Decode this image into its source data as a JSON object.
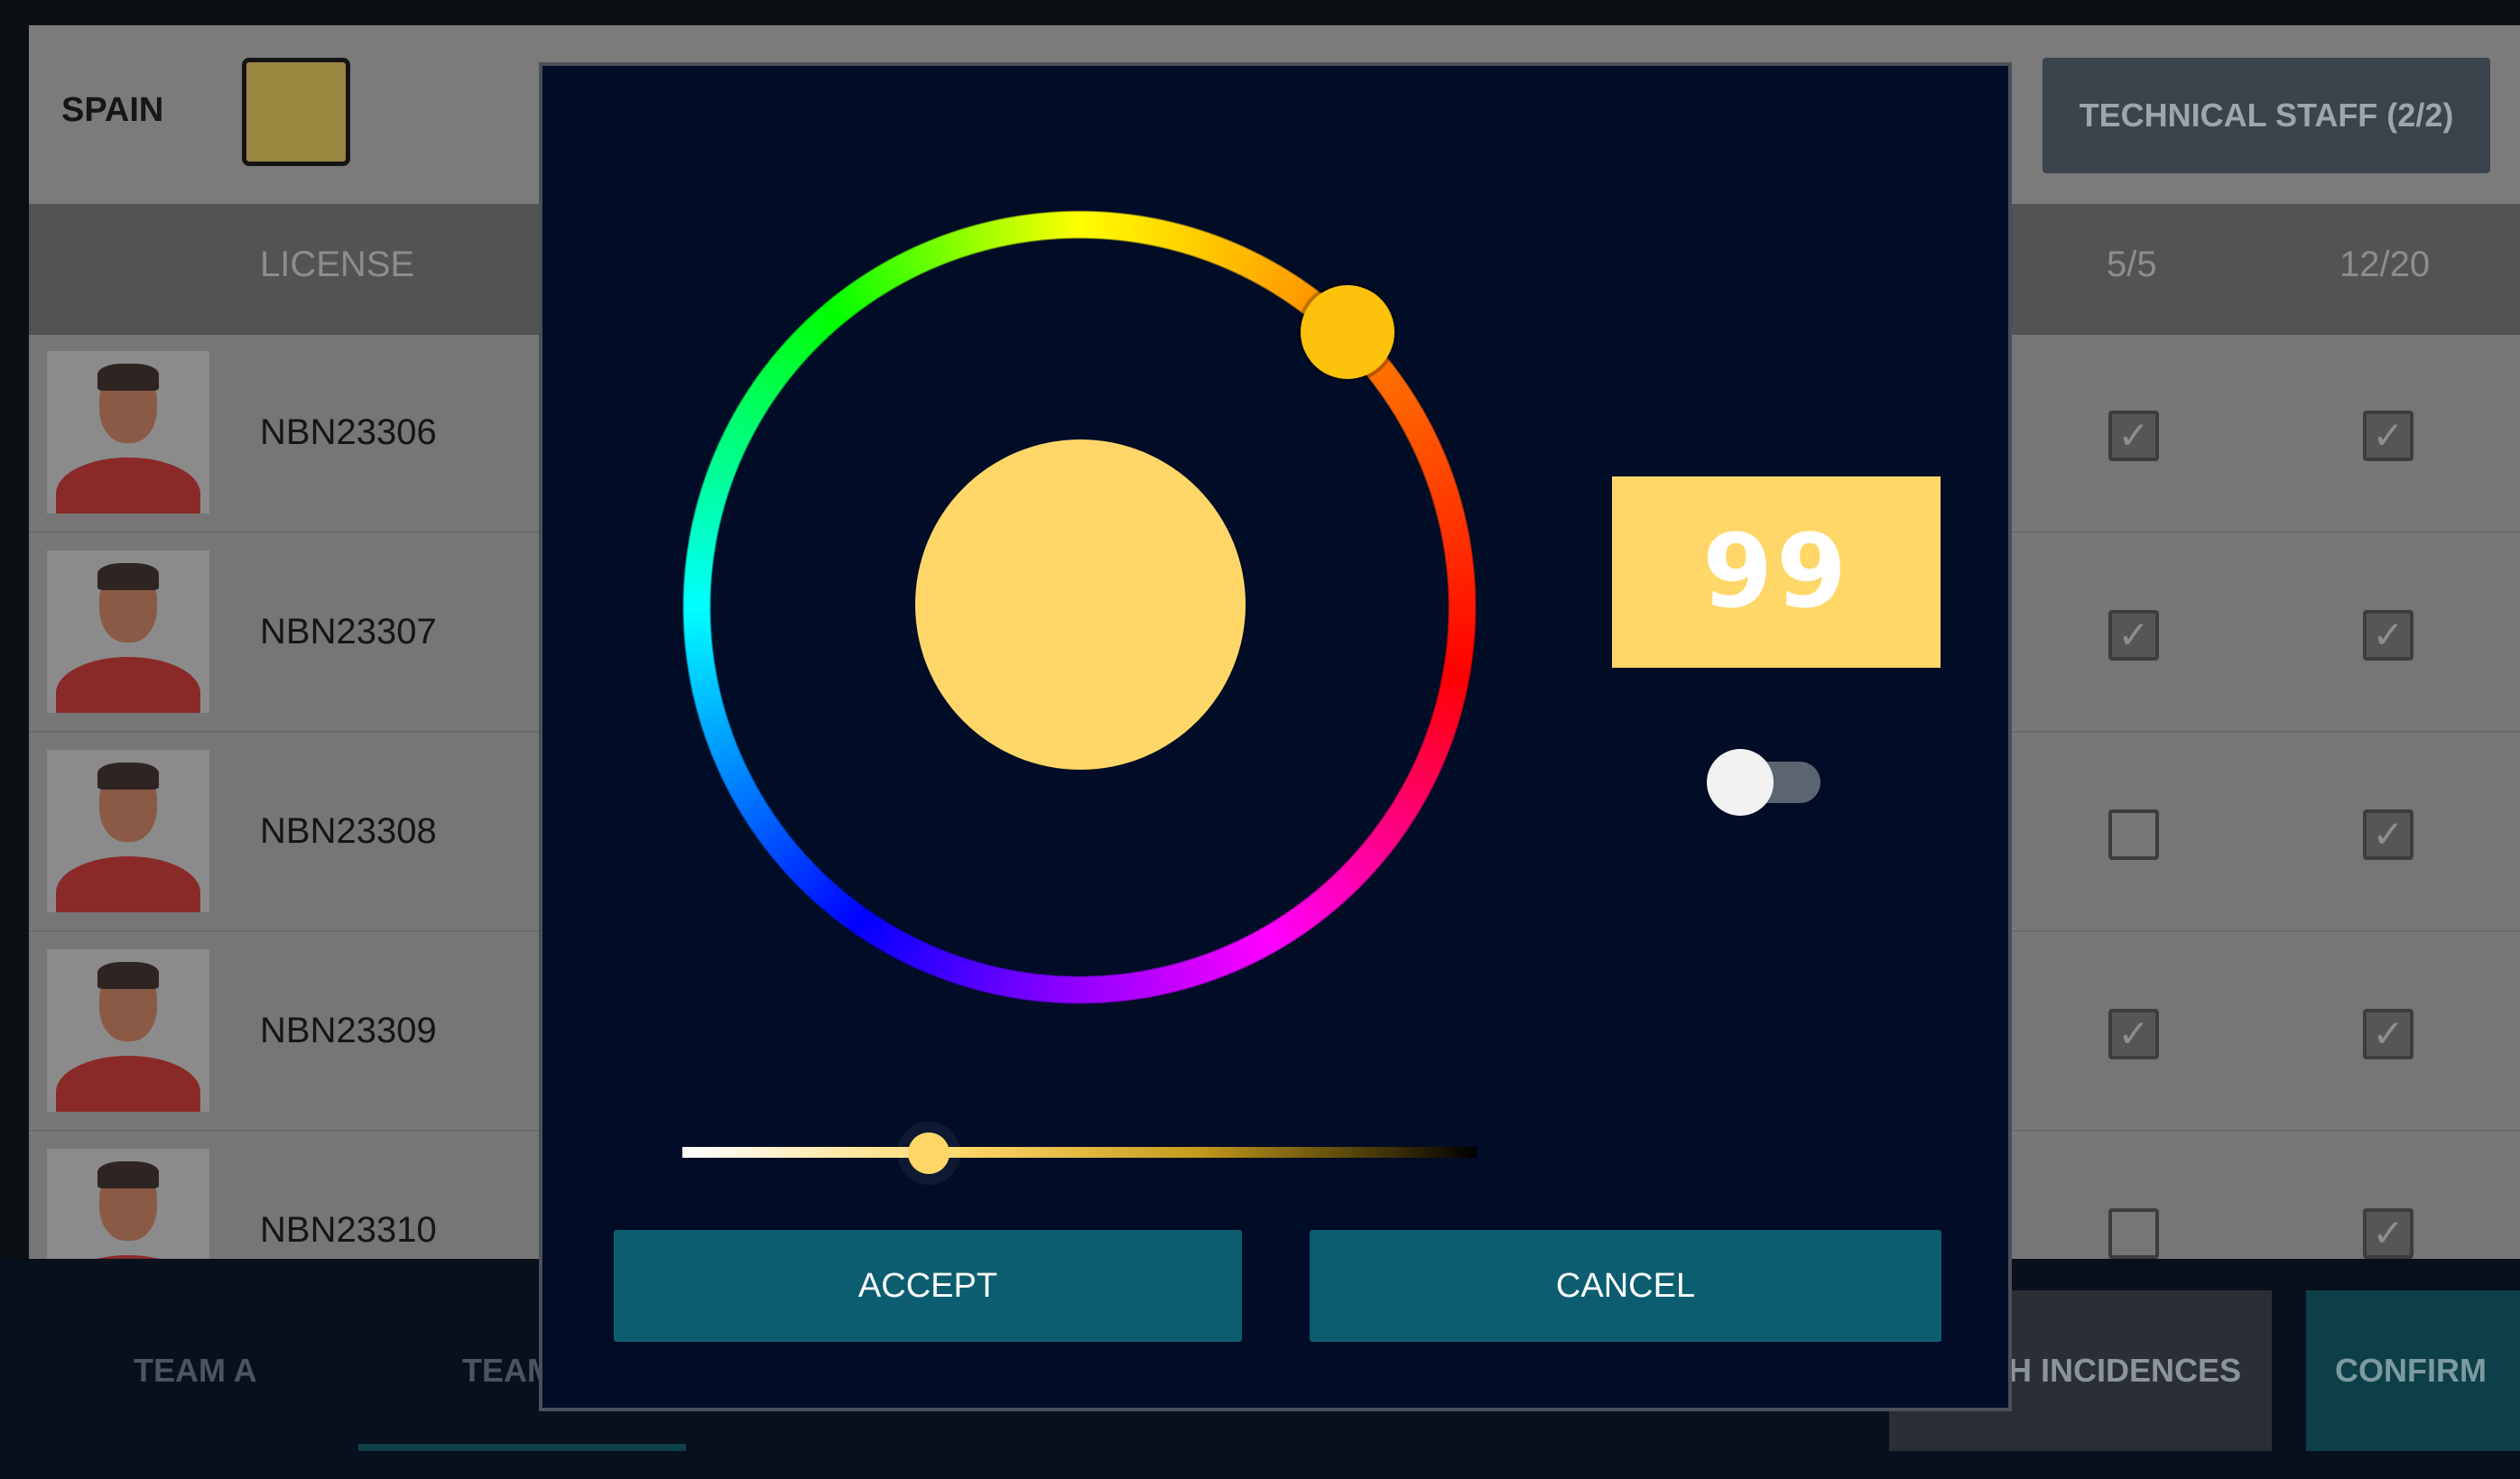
{
  "team": {
    "name": "SPAIN",
    "color": "#9a8740"
  },
  "header": {
    "staff_button": "TECHNICAL STAFF (2/2)"
  },
  "columns": {
    "license": "LICENSE",
    "col_a": "5/5",
    "col_b": "12/20"
  },
  "players": [
    {
      "license": "NBN23306",
      "a": true,
      "b": true
    },
    {
      "license": "NBN23307",
      "a": true,
      "b": true
    },
    {
      "license": "NBN23308",
      "a": false,
      "b": true
    },
    {
      "license": "NBN23309",
      "a": true,
      "b": true
    },
    {
      "license": "NBN23310",
      "a": false,
      "b": true
    }
  ],
  "check_mark": "✓",
  "bottom": {
    "tab_a": "TEAM A",
    "tab_b": "TEAM",
    "incidences": "H INCIDENCES",
    "confirm": "CONFIRM"
  },
  "picker": {
    "value": "99",
    "selected_color": "#ffd768",
    "hue_knob_color": "#fcc10a",
    "toggle_on": false,
    "brightness_level": 0.31,
    "accept_label": "ACCEPT",
    "cancel_label": "CANCEL"
  }
}
